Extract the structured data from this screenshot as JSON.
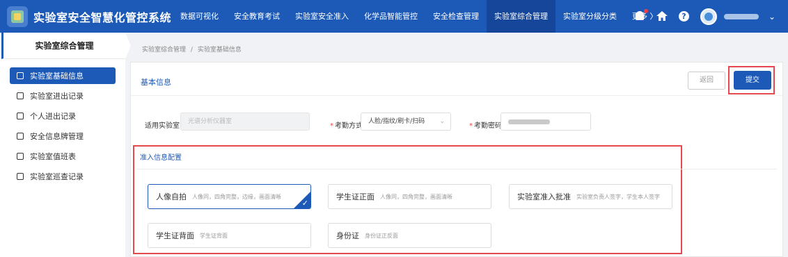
{
  "app": {
    "title": "实验室安全智慧化管控系统"
  },
  "nav": {
    "items": [
      "数据可视化",
      "安全教育考试",
      "实验室安全准入",
      "化学品智能管控",
      "安全检查管理",
      "实验室综合管理",
      "实验室分级分类"
    ],
    "active_index": 5,
    "more_label": "更多 〉"
  },
  "sidebar": {
    "title": "实验室综合管理",
    "items": [
      {
        "label": "实验室基础信息",
        "active": true
      },
      {
        "label": "实验室进出记录",
        "active": false
      },
      {
        "label": "个人进出记录",
        "active": false
      },
      {
        "label": "安全信息牌管理",
        "active": false
      },
      {
        "label": "实验室值班表",
        "active": false
      },
      {
        "label": "实验室巡查记录",
        "active": false
      }
    ]
  },
  "breadcrumb": {
    "root": "实验室综合管理",
    "separator": "/",
    "current": "实验室基础信息"
  },
  "basic": {
    "title": "基本信息",
    "back_label": "返回",
    "submit_label": "提交",
    "lab_label": "适用实验室:",
    "lab_value": "光谱分析仪器室",
    "attendance_label": "考勤方式",
    "attendance_value": "人脸/指纹/刷卡/扫码",
    "password_label": "考勤密码:"
  },
  "access_config": {
    "title": "准入信息配置",
    "cards": [
      {
        "name": "人像自拍",
        "desc": "人像同，四角完整，边缘，画面清晰",
        "selected": true
      },
      {
        "name": "学生证正面",
        "desc": "人像同，四角完整，画面清晰",
        "selected": false
      },
      {
        "name": "实验室准入批准",
        "desc": "实验室负责人签字，学生本人签字",
        "selected": false
      },
      {
        "name": "学生证背面",
        "desc": "学生证背面",
        "selected": false
      },
      {
        "name": "身份证",
        "desc": "身份证正反面",
        "selected": false
      }
    ]
  },
  "colors": {
    "primary": "#1d5ab8",
    "highlight": "#e5484d"
  }
}
